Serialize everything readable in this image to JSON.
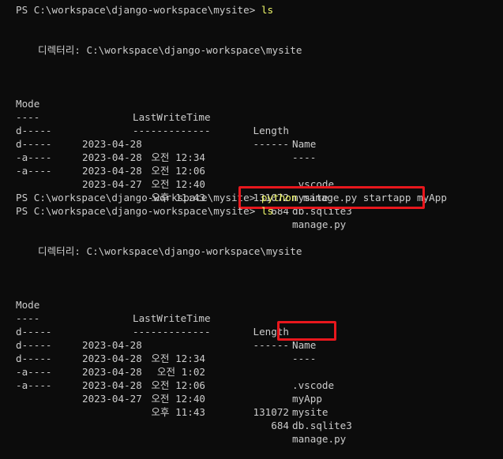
{
  "session": {
    "prompt": "PS C:\\workspace\\django-workspace\\mysite> ",
    "cmd1": "ls",
    "cmd2_bin": "python",
    "cmd2_args": " manage.py startapp myApp",
    "cmd3": "ls"
  },
  "listing1": {
    "directory_line": "디렉터리: C:\\workspace\\django-workspace\\mysite",
    "headers": {
      "mode": "Mode",
      "time": "LastWriteTime",
      "length": "Length",
      "name": "Name"
    },
    "rules": {
      "mode": "----",
      "time": "-------------",
      "length": "------",
      "name": "----"
    },
    "rows": [
      {
        "mode": "d-----",
        "date": "2023-04-28",
        "time": "오전 12:34",
        "length": "",
        "name": ".vscode"
      },
      {
        "mode": "d-----",
        "date": "2023-04-28",
        "time": "오전 12:06",
        "length": "",
        "name": "mysite"
      },
      {
        "mode": "-a----",
        "date": "2023-04-28",
        "time": "오전 12:40",
        "length": "131072",
        "name": "db.sqlite3"
      },
      {
        "mode": "-a----",
        "date": "2023-04-27",
        "time": "오후 11:43",
        "length": "684",
        "name": "manage.py"
      }
    ]
  },
  "listing2": {
    "directory_line": "디렉터리: C:\\workspace\\django-workspace\\mysite",
    "headers": {
      "mode": "Mode",
      "time": "LastWriteTime",
      "length": "Length",
      "name": "Name"
    },
    "rules": {
      "mode": "----",
      "time": "-------------",
      "length": "------",
      "name": "----"
    },
    "rows": [
      {
        "mode": "d-----",
        "date": "2023-04-28",
        "time": "오전 12:34",
        "length": "",
        "name": ".vscode"
      },
      {
        "mode": "d-----",
        "date": "2023-04-28",
        "time": "오전 1:02",
        "length": "",
        "name": "myApp"
      },
      {
        "mode": "d-----",
        "date": "2023-04-28",
        "time": "오전 12:06",
        "length": "",
        "name": "mysite"
      },
      {
        "mode": "-a----",
        "date": "2023-04-28",
        "time": "오전 12:40",
        "length": "131072",
        "name": "db.sqlite3"
      },
      {
        "mode": "-a----",
        "date": "2023-04-27",
        "time": "오후 11:43",
        "length": "684",
        "name": "manage.py"
      }
    ]
  },
  "colors": {
    "background": "#0c0c0c",
    "foreground": "#cccccc",
    "command_yellow": "#f1fa6b",
    "highlight_red": "#e8171d"
  }
}
